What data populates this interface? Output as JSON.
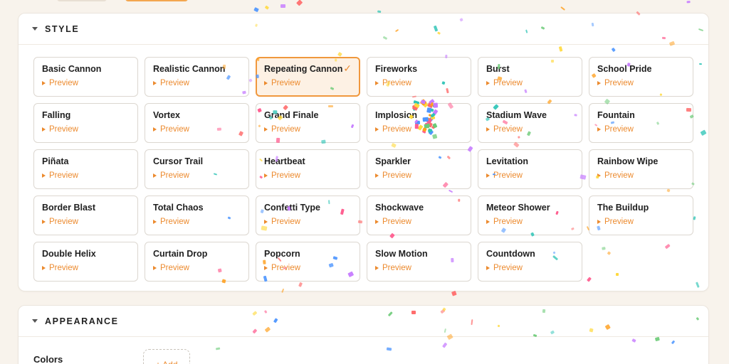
{
  "sections": {
    "style": {
      "title": "STYLE",
      "preview_label": "Preview",
      "selected": "Repeating Cannon",
      "styles": [
        "Basic Cannon",
        "Realistic Cannon",
        "Repeating Cannon",
        "Fireworks",
        "Burst",
        "School Pride",
        "Falling",
        "Vortex",
        "Grand Finale",
        "Implosion",
        "Stadium Wave",
        "Fountain",
        "Piñata",
        "Cursor Trail",
        "Heartbeat",
        "Sparkler",
        "Levitation",
        "Rainbow Wipe",
        "Border Blast",
        "Total Chaos",
        "Confetti Type",
        "Shockwave",
        "Meteor Shower",
        "The Buildup",
        "Double Helix",
        "Curtain Drop",
        "Popcorn",
        "Slow Motion",
        "Countdown"
      ]
    },
    "appearance": {
      "title": "APPEARANCE",
      "colors_label": "Colors",
      "add_label": "+ Add"
    }
  },
  "confetti_colors": [
    "#ff6b6b",
    "#ffd93d",
    "#6bcB77",
    "#4d96ff",
    "#c77dff",
    "#ff9f1c",
    "#2ec4b6",
    "#ff5d8f"
  ],
  "icons": {
    "section_toggle": "caret-down-icon",
    "selected_mark": "checkmark-icon",
    "preview": "play-triangle-icon"
  },
  "accent_color": "#ec8a2e"
}
